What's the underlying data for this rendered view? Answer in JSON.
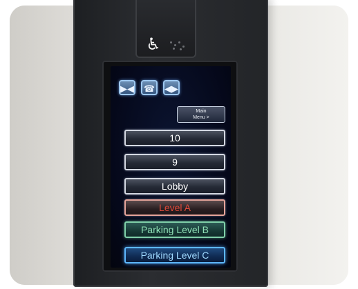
{
  "elevator": {
    "accessibility_icon": "wheelchair-icon",
    "top_icons": [
      {
        "name": "door-close-icon",
        "glyph": "▶◀"
      },
      {
        "name": "alarm-bell-icon",
        "glyph": "☎"
      },
      {
        "name": "door-open-icon",
        "glyph": "◀▶"
      }
    ],
    "menu_button": {
      "line1": "Main",
      "line2": "Menu >"
    },
    "floors": [
      {
        "label": "10",
        "style": "default"
      },
      {
        "label": "9",
        "style": "default"
      },
      {
        "label": "Lobby",
        "style": "default"
      },
      {
        "label": "Level A",
        "style": "red"
      },
      {
        "label": "Parking Level B",
        "style": "green"
      },
      {
        "label": "Parking Level C",
        "style": "blue"
      }
    ]
  }
}
